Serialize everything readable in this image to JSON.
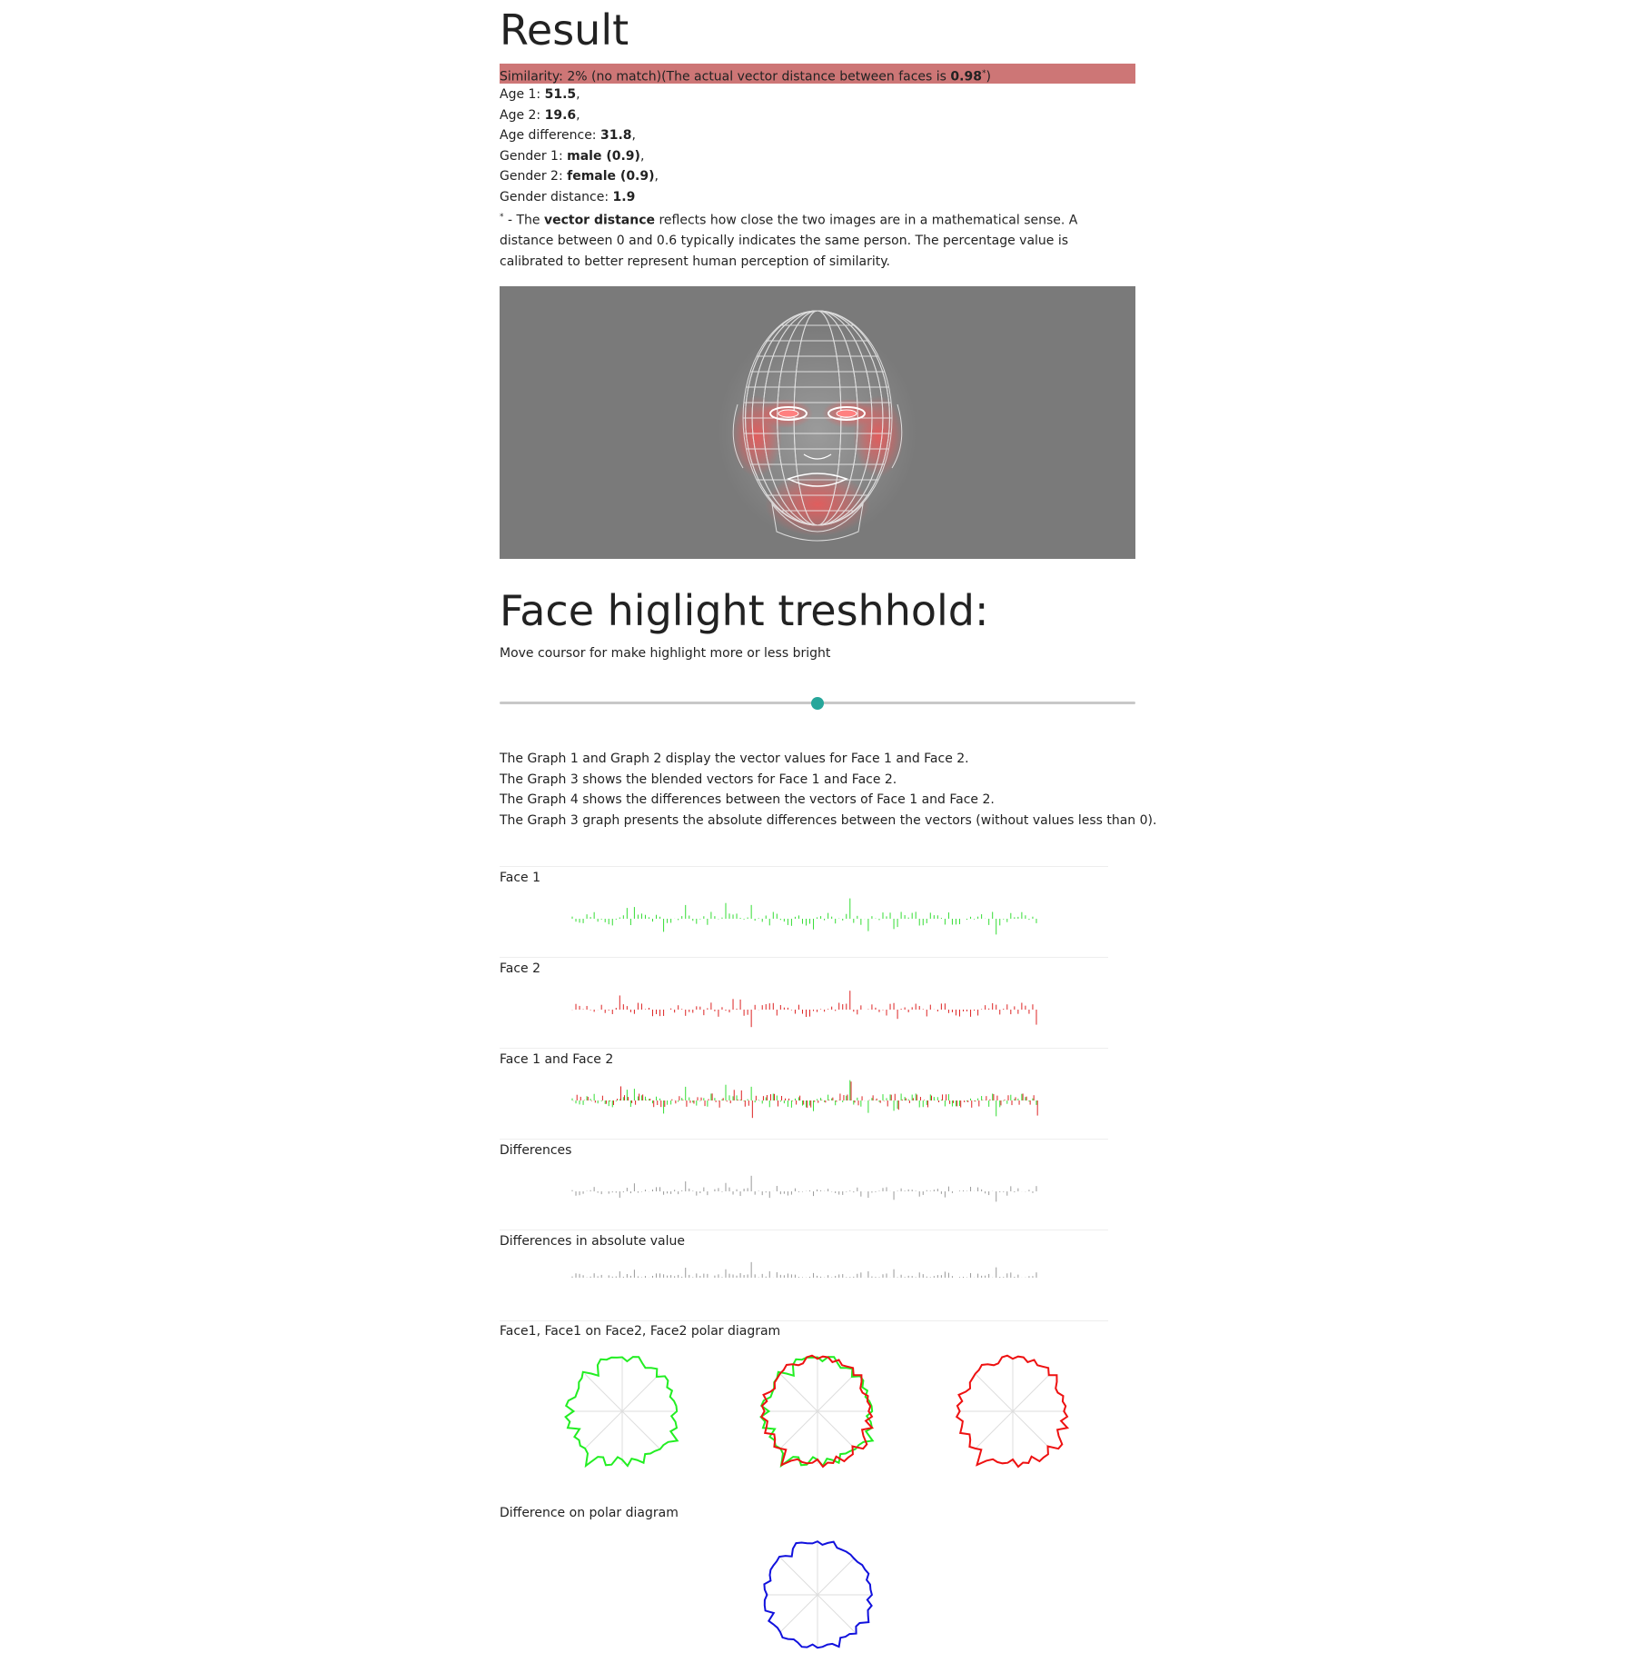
{
  "result": {
    "title": "Result",
    "similarity": {
      "prefix": "Similarity: 2% (no match)(The actual vector distance between faces is ",
      "value": "0.98",
      "mark": "*",
      "suffix": ")"
    },
    "stats": [
      {
        "label": "Age 1: ",
        "value": "51.5",
        "tail": ","
      },
      {
        "label": "Age 2: ",
        "value": "19.6",
        "tail": ","
      },
      {
        "label": "Age difference: ",
        "value": "31.8",
        "tail": ","
      },
      {
        "label": "Gender 1: ",
        "value": "male (0.9)",
        "tail": ","
      },
      {
        "label": "Gender 2: ",
        "value": "female (0.9)",
        "tail": ","
      },
      {
        "label": "Gender distance: ",
        "value": "1.9",
        "tail": ""
      }
    ],
    "note": {
      "mark": "*",
      "pre": " - The ",
      "bold": "vector distance",
      "post": " reflects how close the two images are in a mathematical sense. A distance between 0 and 0.6 typically indicates the same person. The percentage value is calibrated to better represent human perception of similarity."
    },
    "colors": {
      "similarity_bar": "#cd7676",
      "face_panel": "#7a7a7a",
      "highlight": "#ff5050"
    }
  },
  "threshold": {
    "title": "Face higlight treshhold:",
    "hint": "Move coursor for make highlight more or less bright",
    "slider_value": 0.5,
    "thumb_color": "#26a69a"
  },
  "explanation": [
    "The Graph 1 and Graph 2 display the vector values for Face 1 and Face 2.",
    "The Graph 3 shows the blended vectors for Face 1 and Face 2.",
    "The Graph 4 shows the differences between the vectors of Face 1 and Face 2.",
    "The Graph 3 graph presents the absolute differences between the vectors (without values less than 0)."
  ],
  "graphs": [
    {
      "label": "Face 1",
      "colors": [
        "#33dd33"
      ]
    },
    {
      "label": "Face 2",
      "colors": [
        "#dd2222"
      ]
    },
    {
      "label": "Face 1 and Face 2",
      "colors": [
        "#33dd33",
        "#dd2222"
      ]
    },
    {
      "label": "Differences",
      "colors": [
        "#999999"
      ]
    },
    {
      "label": "Differences in absolute value",
      "colors": [
        "#999999"
      ]
    }
  ],
  "polar": {
    "label": "Face1, Face1 on Face2, Face2 polar diagram",
    "diff_label": "Difference on polar diagram",
    "colors": {
      "face1": "#22ee22",
      "face2": "#ee1111",
      "diff": "#1111dd",
      "grid": "#dddddd"
    }
  }
}
